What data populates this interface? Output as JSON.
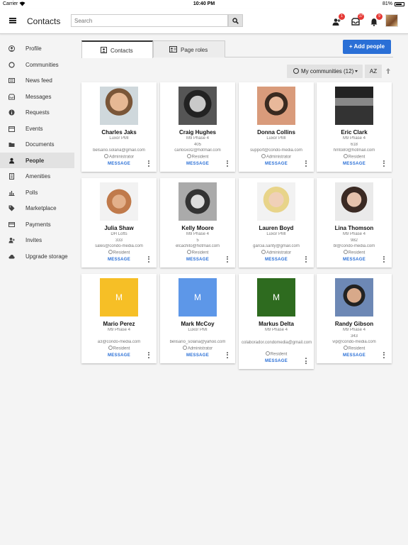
{
  "status": {
    "carrier": "Carrier",
    "time": "10:40 PM",
    "battery": "81%",
    "battery_level": 0.81
  },
  "header": {
    "title": "Contacts",
    "search_placeholder": "Search",
    "badges": {
      "friend_requests": "1",
      "messages": "17",
      "notifications": "9"
    }
  },
  "sidebar": {
    "items": [
      {
        "label": "Profile",
        "icon": "person-circle-icon"
      },
      {
        "label": "Communities",
        "icon": "circle-icon"
      },
      {
        "label": "News feed",
        "icon": "newspaper-icon"
      },
      {
        "label": "Messages",
        "icon": "inbox-icon"
      },
      {
        "label": "Requests",
        "icon": "info-icon"
      },
      {
        "label": "Events",
        "icon": "calendar-icon"
      },
      {
        "label": "Documents",
        "icon": "folder-icon"
      },
      {
        "label": "People",
        "icon": "person-icon"
      },
      {
        "label": "Amenities",
        "icon": "building-icon"
      },
      {
        "label": "Polls",
        "icon": "bar-chart-icon"
      },
      {
        "label": "Marketplace",
        "icon": "tag-icon"
      },
      {
        "label": "Payments",
        "icon": "credit-card-icon"
      },
      {
        "label": "Invites",
        "icon": "add-person-icon"
      },
      {
        "label": "Upgrade storage",
        "icon": "cloud-icon"
      }
    ],
    "active": "People"
  },
  "tabs": [
    {
      "label": "Contacts"
    },
    {
      "label": "Page roles"
    }
  ],
  "add_button": "+ Add people",
  "filter": {
    "label": "My communities (12)",
    "sort": "AZ"
  },
  "contact_message_label": "MESSAGE",
  "contacts": [
    {
      "name": "Charles Jaks",
      "lines": [
        "Luxor PMI"
      ],
      "email": "belsario.solana@gmail.com",
      "role": "Administrator"
    },
    {
      "name": "Craig Hughes",
      "lines": [
        "M9 Phase 4",
        "405"
      ],
      "email": "carlosxol2@hotmail.com",
      "role": "Resident"
    },
    {
      "name": "Donna Collins",
      "lines": [
        "Luxor PMI"
      ],
      "email": "support@condo-media.com",
      "role": "Administrator"
    },
    {
      "name": "Eric Clark",
      "lines": [
        "M9 Phase 4",
        "618"
      ],
      "email": "hmto80@hotmail.com",
      "role": "Resident"
    },
    {
      "name": "Julia Shaw",
      "lines": [
        "DH Lofts",
        "333"
      ],
      "email": "sales@condo-media.com",
      "role": "Resident"
    },
    {
      "name": "Kelly Moore",
      "lines": [
        "M9 Phase 4",
        "5"
      ],
      "email": "elcachito@hotmail.com",
      "role": "Resident"
    },
    {
      "name": "Lauren Boyd",
      "lines": [
        "Luxor PMI"
      ],
      "email": "garcia.santy@gmail.com",
      "role": "Administrator"
    },
    {
      "name": "Lina Thomson",
      "lines": [
        "M9 Phase 4",
        "982"
      ],
      "email": "bl@condo-media.com",
      "role": "Resident"
    },
    {
      "name": "Mario Perez",
      "lines": [
        "M9 Phase 4"
      ],
      "email": "a3@condo-media.com",
      "role": "Resident",
      "initial": "M",
      "color": "#f6bf26"
    },
    {
      "name": "Mark McCoy",
      "lines": [
        "Luxor PMI"
      ],
      "email": "belisario_solana@yahoo.com",
      "role": "Administrator",
      "initial": "M",
      "color": "#5d97e8"
    },
    {
      "name": "Markus Delta",
      "lines": [
        "M9 Phase 4"
      ],
      "email": "colaborador.condomedia@gmail.com",
      "role": "Resident",
      "initial": "M",
      "color": "#2e6b1f"
    },
    {
      "name": "Randy Gibson",
      "lines": [
        "M9 Phase 4",
        "343"
      ],
      "email": "vip@condo-media.com",
      "role": "Resident"
    }
  ],
  "colors": {
    "accent": "#2a6fd6",
    "badge": "#e53935"
  }
}
